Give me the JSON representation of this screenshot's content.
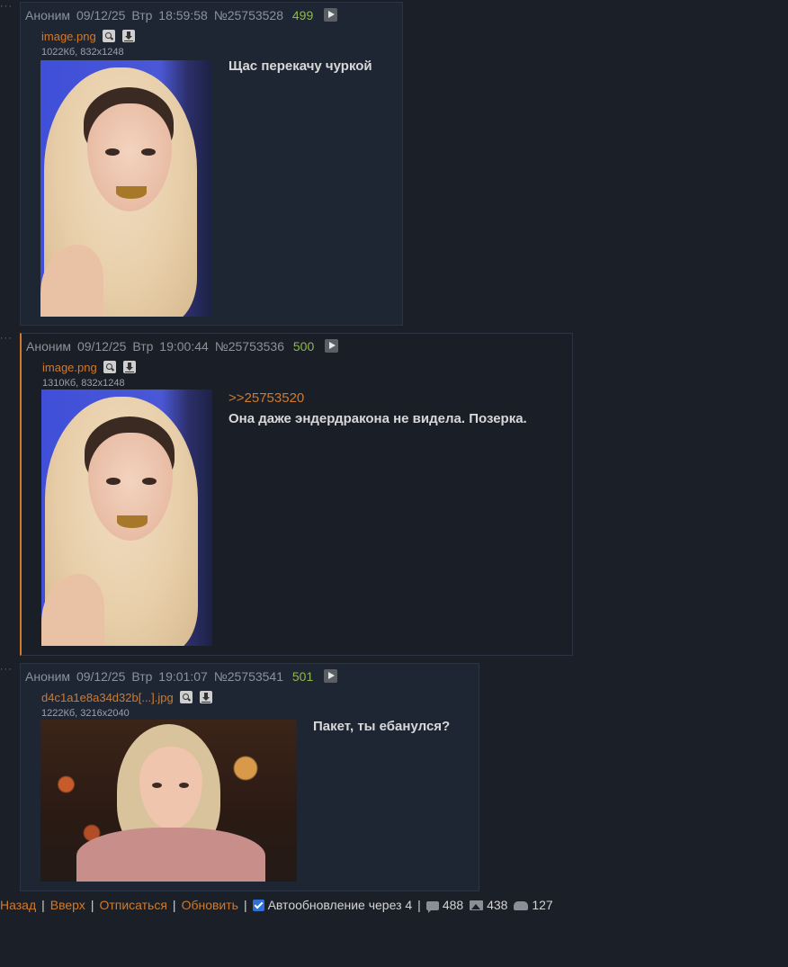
{
  "posts": [
    {
      "author": "Аноним",
      "date": "09/12/25",
      "weekday": "Втр",
      "time": "18:59:58",
      "number": "№25753528",
      "count": "499",
      "file": {
        "name": "image.png",
        "meta": "1022Кб, 832x1248"
      },
      "reply_ref": "",
      "text": "Щас перекачу чуркой"
    },
    {
      "author": "Аноним",
      "date": "09/12/25",
      "weekday": "Втр",
      "time": "19:00:44",
      "number": "№25753536",
      "count": "500",
      "file": {
        "name": "image.png",
        "meta": "1310Кб, 832x1248"
      },
      "reply_ref": ">>25753520",
      "text": "Она даже эндердракона не видела. Позерка."
    },
    {
      "author": "Аноним",
      "date": "09/12/25",
      "weekday": "Втр",
      "time": "19:01:07",
      "number": "№25753541",
      "count": "501",
      "file": {
        "name": "d4c1a1e8a34d32b[...].jpg",
        "meta": "1222Кб, 3216x2040"
      },
      "reply_ref": "",
      "text": "Пакет, ты ебанулся?"
    }
  ],
  "footer": {
    "back": "Назад",
    "top": "Вверх",
    "unsubscribe": "Отписаться",
    "refresh": "Обновить",
    "autoupdate_label": "Автообновление через 4",
    "autoupdate_checked": true,
    "posts_count": "488",
    "images_count": "438",
    "users_count": "127"
  },
  "colors": {
    "accent": "#d07a2c",
    "count_green": "#8fb84a",
    "background": "#1b1f28",
    "post_bg": "#1f2633"
  },
  "icons": [
    "play-icon",
    "search-icon",
    "download-icon",
    "comment-icon",
    "image-icon",
    "users-icon",
    "checkbox-icon"
  ]
}
